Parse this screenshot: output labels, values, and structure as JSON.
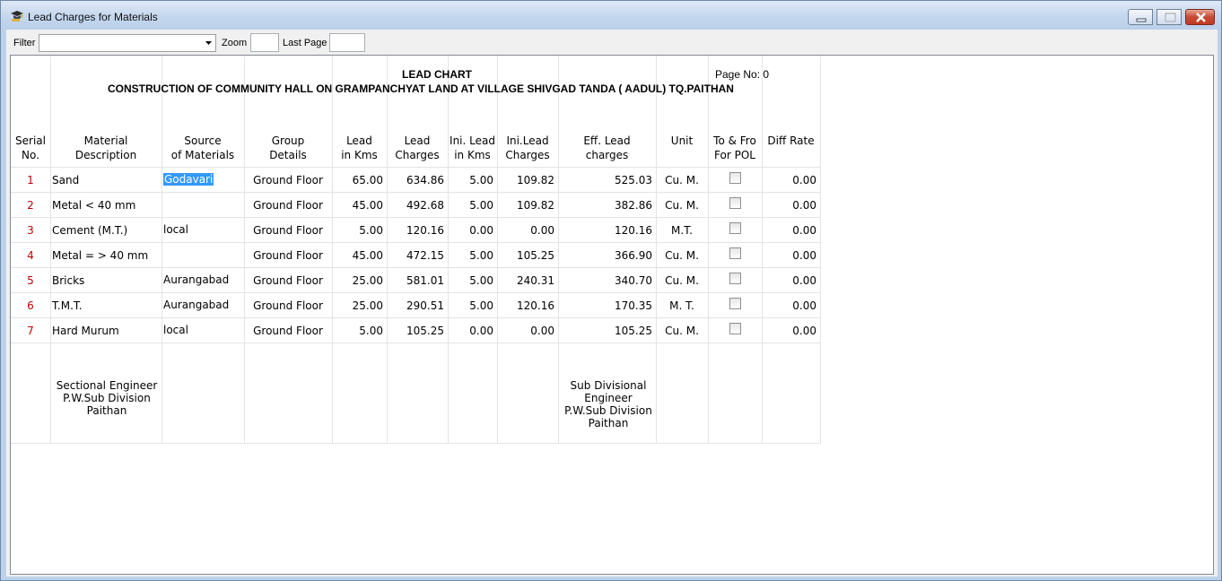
{
  "window": {
    "title": "Lead Charges for Materials"
  },
  "toolbar": {
    "filter_label": "Filter",
    "filter_value": "",
    "zoom_label": "Zoom",
    "zoom_value": "",
    "last_page_label": "Last Page",
    "last_page_value": ""
  },
  "report": {
    "heading": "LEAD CHART",
    "subheading": "CONSTRUCTION OF COMMUNITY HALL ON GRAMPANCHYAT LAND AT VILLAGE SHIVGAD TANDA ( AADUL) TQ.PAITHAN",
    "page_no": "Page No: 0",
    "columns": [
      [
        "Serial",
        "No."
      ],
      [
        "Material",
        "Description"
      ],
      [
        "Source",
        "of Materials"
      ],
      [
        "Group",
        "Details"
      ],
      [
        "Lead",
        "in Kms"
      ],
      [
        "Lead",
        "Charges"
      ],
      [
        "Ini. Lead",
        "in Kms"
      ],
      [
        "Ini.Lead",
        "Charges"
      ],
      [
        "Eff. Lead",
        "charges"
      ],
      [
        "Unit",
        ""
      ],
      [
        "To & Fro",
        "For POL"
      ],
      [
        "Diff Rate",
        ""
      ]
    ],
    "rows": [
      {
        "serial": "1",
        "material": "Sand",
        "source": "Godavari",
        "group": "Ground Floor",
        "lead_kms": "65.00",
        "lead_charges": "634.86",
        "ini_lead_kms": "5.00",
        "ini_lead_charges": "109.82",
        "eff_lead": "525.03",
        "unit": "Cu. M.",
        "pol": false,
        "diff_rate": "0.00"
      },
      {
        "serial": "2",
        "material": "Metal < 40 mm",
        "source": "",
        "group": "Ground Floor",
        "lead_kms": "45.00",
        "lead_charges": "492.68",
        "ini_lead_kms": "5.00",
        "ini_lead_charges": "109.82",
        "eff_lead": "382.86",
        "unit": "Cu. M.",
        "pol": false,
        "diff_rate": "0.00"
      },
      {
        "serial": "3",
        "material": "Cement (M.T.)",
        "source": "local",
        "group": "Ground Floor",
        "lead_kms": "5.00",
        "lead_charges": "120.16",
        "ini_lead_kms": "0.00",
        "ini_lead_charges": "0.00",
        "eff_lead": "120.16",
        "unit": "M.T.",
        "pol": false,
        "diff_rate": "0.00"
      },
      {
        "serial": "4",
        "material": "Metal = > 40 mm",
        "source": "",
        "group": "Ground Floor",
        "lead_kms": "45.00",
        "lead_charges": "472.15",
        "ini_lead_kms": "5.00",
        "ini_lead_charges": "105.25",
        "eff_lead": "366.90",
        "unit": "Cu. M.",
        "pol": false,
        "diff_rate": "0.00"
      },
      {
        "serial": "5",
        "material": "Bricks",
        "source": "Aurangabad",
        "group": "Ground Floor",
        "lead_kms": "25.00",
        "lead_charges": "581.01",
        "ini_lead_kms": "5.00",
        "ini_lead_charges": "240.31",
        "eff_lead": "340.70",
        "unit": "Cu. M.",
        "pol": false,
        "diff_rate": "0.00"
      },
      {
        "serial": "6",
        "material": "T.M.T.",
        "source": "Aurangabad",
        "group": "Ground Floor",
        "lead_kms": "25.00",
        "lead_charges": "290.51",
        "ini_lead_kms": "5.00",
        "ini_lead_charges": "120.16",
        "eff_lead": "170.35",
        "unit": "M. T.",
        "pol": false,
        "diff_rate": "0.00"
      },
      {
        "serial": "7",
        "material": "Hard Murum",
        "source": "local",
        "group": "Ground Floor",
        "lead_kms": "5.00",
        "lead_charges": "105.25",
        "ini_lead_kms": "0.00",
        "ini_lead_charges": "0.00",
        "eff_lead": "105.25",
        "unit": "Cu. M.",
        "pol": false,
        "diff_rate": "0.00"
      }
    ],
    "signatures": {
      "left": [
        "Sectional Engineer",
        "P.W.Sub Division",
        "Paithan"
      ],
      "right": [
        "Sub Divisional",
        "Engineer",
        "P.W.Sub Division",
        "Paithan"
      ]
    }
  }
}
